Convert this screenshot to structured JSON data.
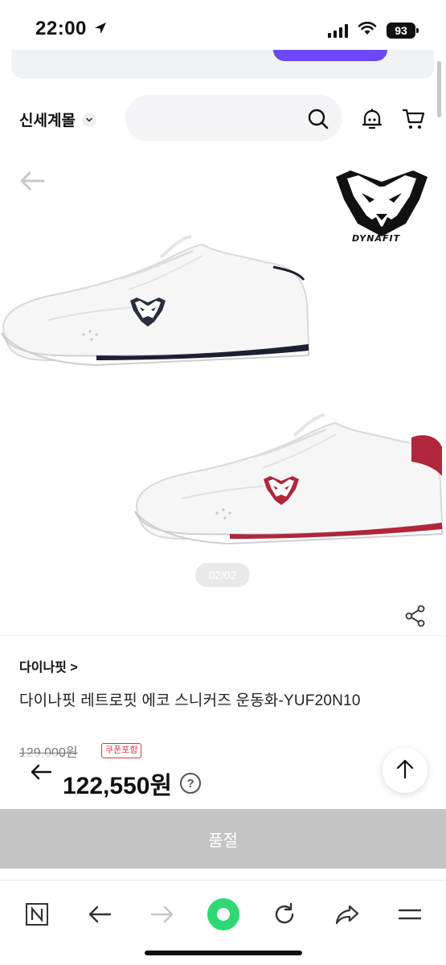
{
  "status_bar": {
    "time": "22:00",
    "battery": "93"
  },
  "header": {
    "store_name": "신세계몰",
    "search_placeholder": ""
  },
  "product_images": {
    "page_indicator": "02/02",
    "brand_logo_text": "DYNAFIT"
  },
  "product": {
    "brand_link": "다이나핏 >",
    "title": "다이나핏 레트로핏 에코 스니커즈 운동화-YUF20N10",
    "original_price": "129,000원",
    "coupon_badge": "쿠폰포함",
    "sale_price": "122,550원",
    "help_symbol": "?"
  },
  "purchase_bar": {
    "label": "품절"
  },
  "colors": {
    "accent_purple": "#6a49f5",
    "discount_red": "#e0344a",
    "soldout_gray": "#c4c4c4",
    "browser_green": "#2fd873"
  },
  "browser_toolbar": {
    "items": [
      "n-tab-icon",
      "back-icon",
      "forward-icon",
      "green-dot-icon",
      "refresh-icon",
      "share-icon",
      "menu-icon"
    ]
  }
}
